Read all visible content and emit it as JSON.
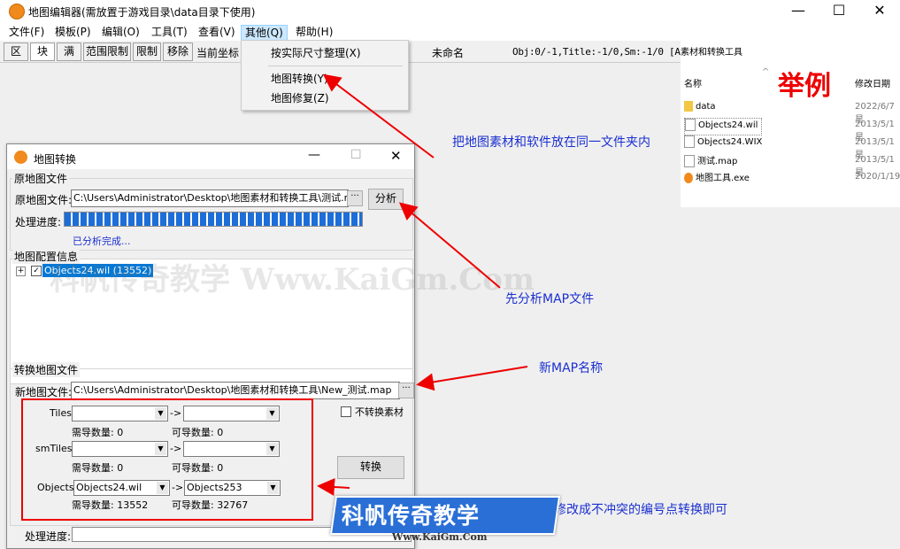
{
  "window": {
    "title": "地图编辑器(需放置于游戏目录\\data目录下使用)",
    "minimize": "—",
    "maximize": "☐",
    "close": "✕"
  },
  "menu": [
    "文件(F)",
    "模板(P)",
    "编辑(O)",
    "工具(T)",
    "查看(V)",
    "其他(Q)",
    "帮助(H)"
  ],
  "toolbar": {
    "buttons": [
      "区",
      "块",
      "满",
      "范围限制",
      "限制",
      "移除",
      "当前坐标"
    ],
    "map_name": "未命名",
    "status": "Obj:0/-1,Title:-1/0,Sm:-1/0 [Ar"
  },
  "dropdown": {
    "items": [
      "按实际尺寸整理(X)",
      "地图转换(Y)",
      "地图修复(Z)"
    ]
  },
  "explorer": {
    "title": "素材和转换工具",
    "col_name": "名称",
    "col_date": "修改日期",
    "files": [
      {
        "name": "data",
        "date": "2022/6/7 星"
      },
      {
        "name": "Objects24.wil",
        "date": "2013/5/1 星"
      },
      {
        "name": "Objects24.WIX",
        "date": "2013/5/1 星"
      },
      {
        "name": "测试.map",
        "date": "2013/5/1 星"
      },
      {
        "name": "地图工具.exe",
        "date": "2020/1/19"
      }
    ]
  },
  "dialog": {
    "title": "地图转换",
    "source_group": "原地图文件",
    "source_label": "原地图文件:",
    "source_path": "C:\\Users\\Administrator\\Desktop\\地图素材和转换工具\\测试.ma",
    "browse": "···",
    "analyze": "分析",
    "progress_label": "处理进度:",
    "progress": 1.0,
    "analysis_done": "已分析完成...",
    "config_group": "地图配置信息",
    "tree_item": "Objects24.wil (13552)",
    "convert_group": "转换地图文件",
    "new_label": "新地图文件:",
    "new_path": "C:\\Users\\Administrator\\Desktop\\地图素材和转换工具\\New_测试.map",
    "no_convert": "不转换素材",
    "rows": [
      {
        "label": "Tiles:",
        "from": "",
        "to": "",
        "need": "需导数量: 0",
        "avail": "可导数量: 0"
      },
      {
        "label": "smTiles:",
        "from": "",
        "to": "",
        "need": "需导数量: 0",
        "avail": "可导数量: 0"
      },
      {
        "label": "Objects:",
        "from": "Objects24.wil",
        "to": "Objects253",
        "need": "需导数量: 13552",
        "avail": "可导数量: 32767"
      }
    ],
    "arrow": "->",
    "convert_btn": "转换",
    "progress2_label": "处理进度:"
  },
  "annotations": {
    "example": "举例",
    "note1": "把地图素材和软件放在同一文件夹内",
    "note2": "先分析MAP文件",
    "note3": "新MAP名称",
    "note4": "修改成不冲突的编号点转换即可",
    "watermark": "科帆传奇教学 Www.KaiGm.Com",
    "banner": "科帆传奇教学",
    "banner_url": "Www.KaiGm.Com"
  },
  "colors": {
    "accent": "#e00000",
    "note": "#1a2fd0",
    "banner": "#2a6fd6"
  }
}
